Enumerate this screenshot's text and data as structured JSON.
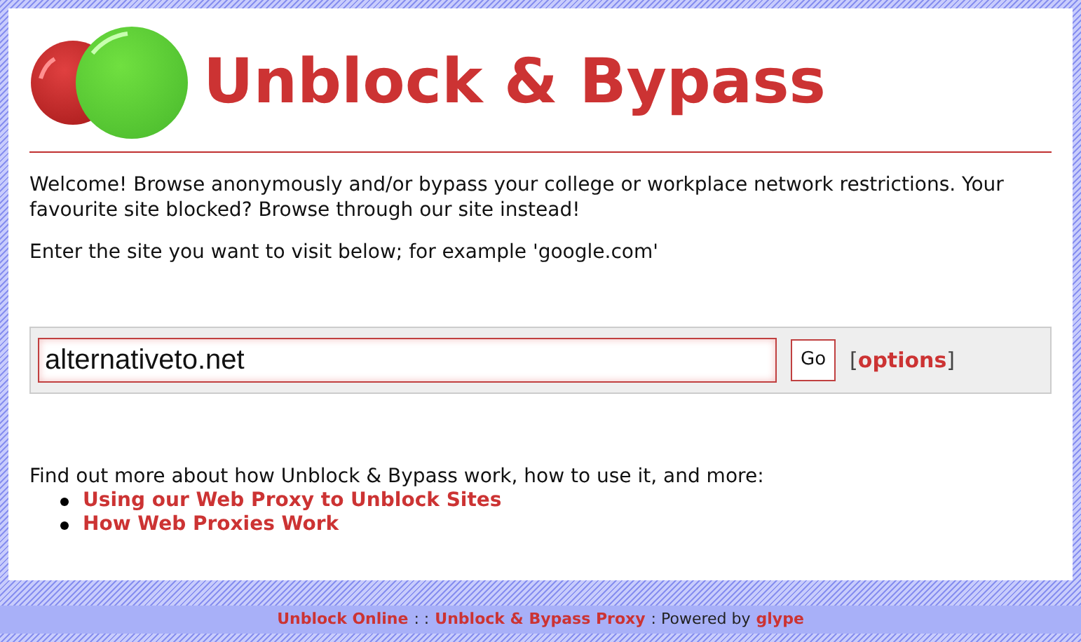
{
  "header": {
    "title": "Unblock & Bypass"
  },
  "intro": [
    "Welcome! Browse anonymously and/or bypass your college or workplace network restrictions. Your favourite site blocked? Browse through our site instead!",
    "Enter the site you want to visit below; for example 'google.com'"
  ],
  "form": {
    "url": "alternativeto.net",
    "button": "Go",
    "open_bracket": "[",
    "options_link": "options",
    "close_bracket": "]"
  },
  "more": {
    "text": "Find out more about how Unblock & Bypass work, how to use it, and more:",
    "links": [
      "Using our Web Proxy to Unblock Sites",
      "How Web Proxies Work"
    ]
  },
  "footer": [
    {
      "kind": "link",
      "text": "Unblock Online"
    },
    {
      "kind": "text",
      "text": ": :"
    },
    {
      "kind": "link",
      "text": "Unblock & Bypass Proxy"
    },
    {
      "kind": "text",
      "text": ": Powered by"
    },
    {
      "kind": "link",
      "text": "glype"
    }
  ]
}
